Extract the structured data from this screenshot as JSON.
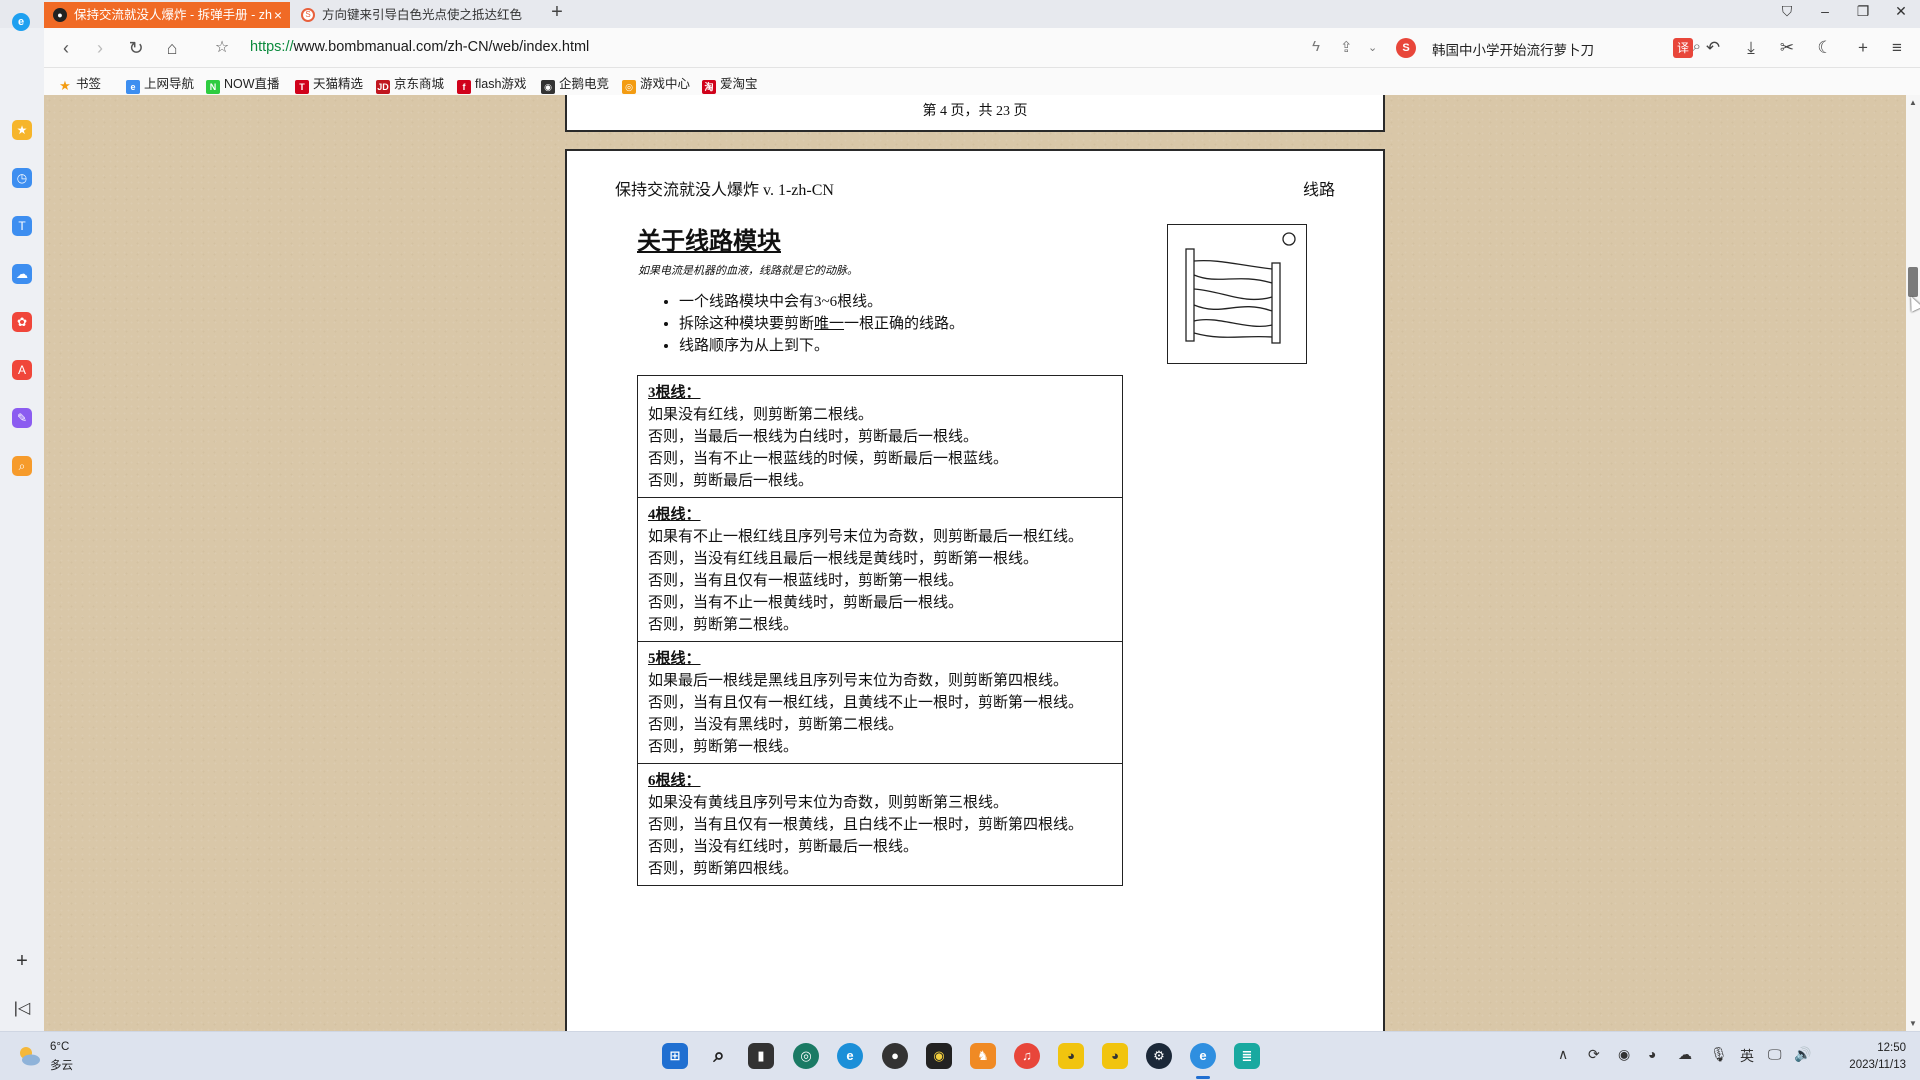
{
  "browser": {
    "tabs": [
      {
        "label": "保持交流就没人爆炸 - 拆弹手册 - zh",
        "active": true
      },
      {
        "label": "方向键来引导白色光点使之抵达红色",
        "active": false
      }
    ],
    "url_protocol": "https://",
    "url_rest": "www.bombmanual.com/zh-CN/web/index.html",
    "search_text": "韩国中小学开始流行萝卜刀",
    "bookmarks": [
      "书签",
      "上网导航",
      "NOW直播",
      "天猫精选",
      "京东商城",
      "flash游戏",
      "企鹅电竞",
      "游戏中心",
      "爱淘宝"
    ]
  },
  "manual": {
    "prev_page_footer": "第 4 页，共 23 页",
    "header_left": "保持交流就没人爆炸 v. 1-zh-CN",
    "header_right": "线路",
    "title": "关于线路模块",
    "subtitle": "如果电流是机器的血液，线路就是它的动脉。",
    "bullets": {
      "b1": "一个线路模块中会有3~6根线。",
      "b2_pre": "拆除这种模块要剪断",
      "b2_em": "唯一",
      "b2_post": "一根正确的线路。",
      "b3": "线路顺序为从上到下。"
    },
    "rules": [
      {
        "title": "3根线：",
        "lines": [
          "如果没有红线，则剪断第二根线。",
          "否则，当最后一根线为白线时，剪断最后一根线。",
          "否则，当有不止一根蓝线的时候，剪断最后一根蓝线。",
          "否则，剪断最后一根线。"
        ]
      },
      {
        "title": "4根线：",
        "lines": [
          "如果有不止一根红线且序列号末位为奇数，则剪断最后一根红线。",
          "否则，当没有红线且最后一根线是黄线时，剪断第一根线。",
          "否则，当有且仅有一根蓝线时，剪断第一根线。",
          "否则，当有不止一根黄线时，剪断最后一根线。",
          "否则，剪断第二根线。"
        ]
      },
      {
        "title": "5根线：",
        "lines": [
          "如果最后一根线是黑线且序列号末位为奇数，则剪断第四根线。",
          "否则，当有且仅有一根红线，且黄线不止一根时，剪断第一根线。",
          "否则，当没有黑线时，剪断第二根线。",
          "否则，剪断第一根线。"
        ]
      },
      {
        "title": "6根线：",
        "lines": [
          "如果没有黄线且序列号末位为奇数，则剪断第三根线。",
          "否则，当有且仅有一根黄线，且白线不止一根时，剪断第四根线。",
          "否则，当没有红线时，剪断最后一根线。",
          "否则，剪断第四根线。"
        ]
      }
    ]
  },
  "taskbar": {
    "temperature": "6°C",
    "weather": "多云",
    "ime": "英",
    "time": "12:50",
    "date": "2023/11/13"
  }
}
